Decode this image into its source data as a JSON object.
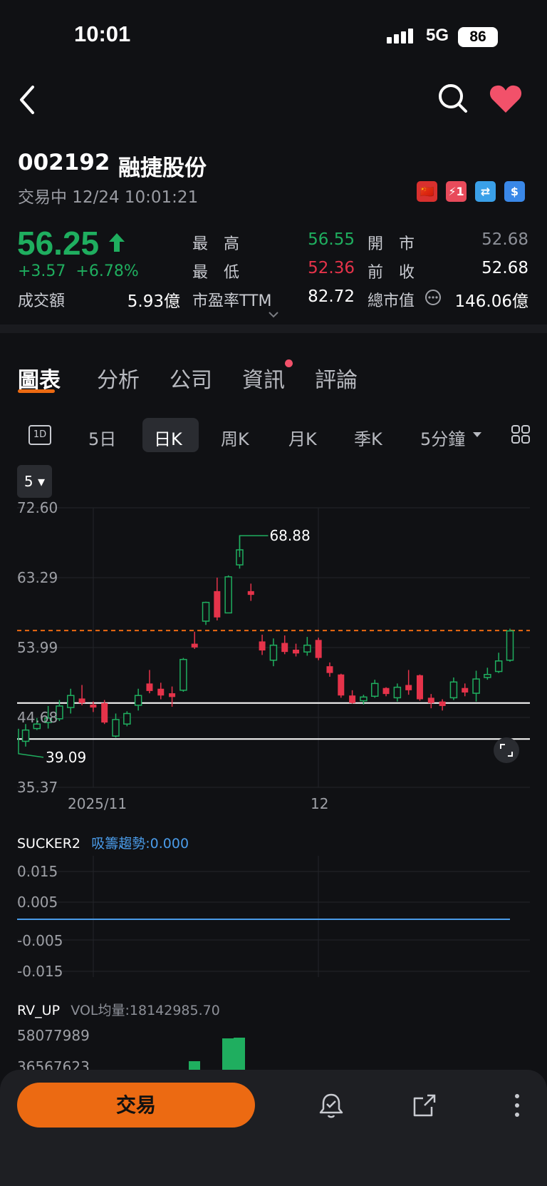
{
  "status_bar": {
    "time": "10:01",
    "network": "5G",
    "battery": "86"
  },
  "header": {
    "back_icon": "chevron-left-icon",
    "search_icon": "search-icon",
    "favorite_icon": "heart-icon",
    "favorite_color": "#f2516a"
  },
  "stock": {
    "code": "002192",
    "name": "融捷股份",
    "trade_status": "交易中 12/24 10:01:21",
    "badges": [
      "🇨🇳",
      "⚡1",
      "⇄",
      "$"
    ],
    "price": "56.25",
    "change": "+3.57",
    "change_pct": "+6.78%",
    "colors": {
      "up": "#1fae5f",
      "down": "#e5334a"
    }
  },
  "quote": {
    "high_label": "最　高",
    "high": "56.55",
    "low_label": "最　低",
    "low": "52.36",
    "open_label": "開　市",
    "open": "52.68",
    "prev_close_label": "前　收",
    "prev_close": "52.68",
    "turnover_label": "成交額",
    "turnover": "5.93億",
    "pe_label": "市盈率TTM",
    "pe": "82.72",
    "mcap_label": "總市值",
    "mcap": "146.06億"
  },
  "tabs": [
    "圖表",
    "分析",
    "公司",
    "資訊",
    "評論"
  ],
  "periods": {
    "icon": "1D",
    "items": [
      "5日",
      "日K",
      "周K",
      "月K",
      "季K",
      "5分鐘"
    ]
  },
  "chart_selector": "5",
  "chart_data": {
    "type": "candlestick",
    "y_ticks": [
      "72.60",
      "63.29",
      "53.99",
      "44.68",
      "35.37"
    ],
    "x_ticks": [
      "2025/11",
      "12"
    ],
    "max_label": "68.88",
    "min_label": "39.09",
    "ylim": [
      35.37,
      72.6
    ],
    "current_price": 56.25,
    "support_lines": [
      46.6,
      41.8
    ],
    "candles": [
      [
        41.5,
        43.0,
        40.8,
        43.8
      ],
      [
        43.2,
        43.8,
        43.0,
        44.6
      ],
      [
        44.0,
        44.6,
        43.2,
        46.2
      ],
      [
        44.5,
        46.2,
        44.2,
        47.0
      ],
      [
        46.0,
        47.6,
        45.2,
        48.5
      ],
      [
        47.2,
        46.6,
        46.3,
        49.0
      ],
      [
        46.4,
        46.0,
        45.4,
        46.8
      ],
      [
        46.6,
        44.0,
        43.8,
        47.0
      ],
      [
        42.2,
        44.4,
        42.0,
        45.2
      ],
      [
        43.8,
        45.2,
        43.5,
        45.5
      ],
      [
        46.3,
        47.6,
        45.6,
        48.5
      ],
      [
        49.2,
        48.2,
        47.9,
        51.0
      ],
      [
        48.5,
        47.6,
        47.1,
        49.3
      ],
      [
        47.9,
        47.4,
        46.1,
        48.8
      ],
      [
        48.3,
        52.4,
        48.1,
        52.6
      ],
      [
        54.5,
        54.0,
        53.8,
        56.1
      ],
      [
        57.5,
        60.0,
        57.0,
        60.1
      ],
      [
        61.5,
        58.0,
        57.6,
        63.3
      ],
      [
        58.6,
        63.4,
        58.6,
        63.6
      ],
      [
        65.0,
        67.0,
        64.5,
        68.88
      ],
      [
        61.5,
        61.0,
        60.2,
        62.5
      ],
      [
        54.8,
        53.6,
        53.0,
        55.7
      ],
      [
        52.3,
        54.3,
        51.5,
        55.2
      ],
      [
        54.6,
        53.4,
        53.1,
        55.6
      ],
      [
        53.7,
        53.2,
        52.8,
        54.5
      ],
      [
        53.4,
        54.3,
        52.9,
        55.4
      ],
      [
        55.0,
        52.6,
        52.3,
        55.3
      ],
      [
        51.5,
        50.6,
        50.1,
        52.0
      ],
      [
        50.4,
        47.6,
        47.3,
        50.5
      ],
      [
        47.6,
        46.6,
        46.5,
        48.3
      ],
      [
        46.9,
        47.4,
        46.4,
        47.7
      ],
      [
        47.5,
        49.2,
        47.3,
        49.7
      ],
      [
        48.6,
        47.8,
        47.5,
        48.7
      ],
      [
        47.3,
        48.7,
        46.8,
        49.2
      ],
      [
        49.0,
        48.3,
        47.7,
        51.0
      ],
      [
        50.3,
        47.1,
        46.9,
        50.4
      ],
      [
        47.3,
        46.6,
        45.9,
        47.8
      ],
      [
        46.8,
        46.2,
        45.6,
        47.1
      ],
      [
        47.3,
        49.4,
        47.0,
        50.0
      ],
      [
        48.6,
        48.0,
        47.5,
        49.2
      ],
      [
        47.9,
        49.8,
        46.8,
        50.9
      ],
      [
        50.0,
        50.4,
        49.7,
        51.3
      ],
      [
        50.8,
        52.2,
        50.6,
        53.3
      ],
      [
        52.3,
        56.2,
        52.1,
        56.5
      ]
    ]
  },
  "indicator1": {
    "name": "SUCKER2",
    "value_text": "吸籌趨勢:0.000",
    "ticks": [
      "0.015",
      "0.005",
      "-0.005",
      "-0.015"
    ]
  },
  "indicator2": {
    "name": "RV_UP",
    "value_text": "VOL均量:18142985.70",
    "ticks": [
      "58077989",
      "36567623"
    ]
  },
  "bottom_bar": {
    "trade_label": "交易",
    "alert_icon": "bell-icon",
    "share_icon": "share-icon",
    "more_icon": "more-vertical-icon"
  }
}
